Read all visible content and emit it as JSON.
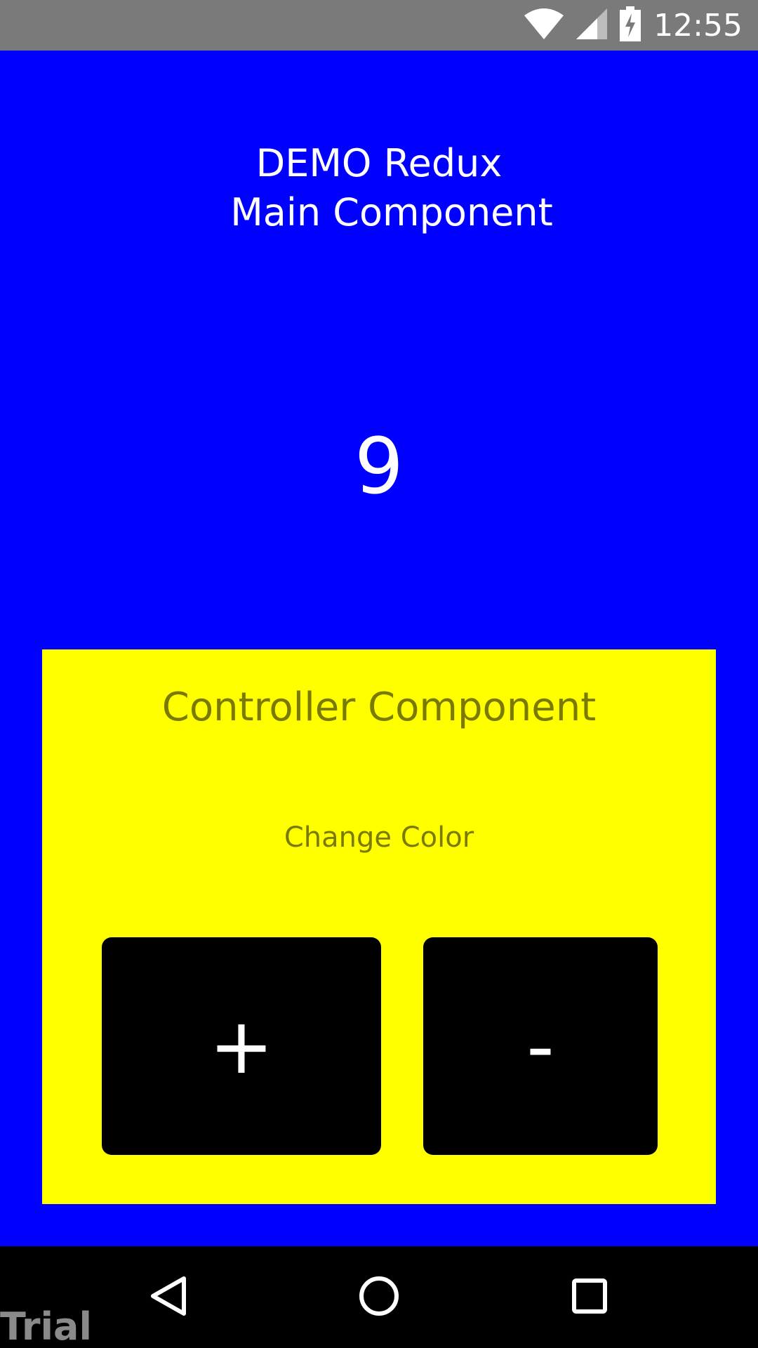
{
  "status_bar": {
    "time": "12:55",
    "icons": [
      "wifi-icon",
      "signal-icon",
      "battery-charging-icon"
    ]
  },
  "main": {
    "title_line1": "DEMO Redux",
    "title_line2": "Main Component",
    "counter_value": "9",
    "background_color": "#0000ff"
  },
  "controller": {
    "title": "Controller Component",
    "change_color_label": "Change Color",
    "plus_label": "+",
    "minus_label": "-",
    "background_color": "#ffff00",
    "text_color": "#7b7a00"
  },
  "nav_bar": {
    "icons": [
      "back-icon",
      "home-icon",
      "recents-icon"
    ],
    "watermark": "Trial"
  }
}
